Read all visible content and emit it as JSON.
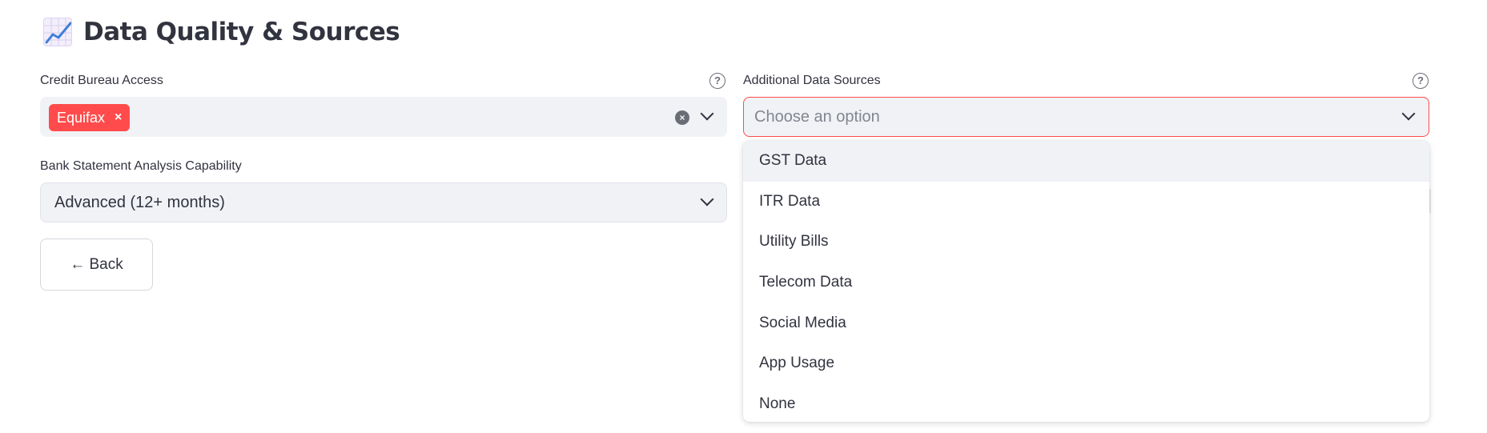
{
  "header": {
    "icon": "chart-increasing-icon",
    "title": "Data Quality & Sources"
  },
  "credit_bureau": {
    "label": "Credit Bureau Access",
    "help_icon": "help-circle-icon",
    "selected_tags": [
      {
        "label": "Equifax",
        "remove_glyph": "×"
      }
    ],
    "clear_glyph": "×",
    "accent_color": "#ff4b4b"
  },
  "additional_sources": {
    "label": "Additional Data Sources",
    "help_icon": "help-circle-icon",
    "placeholder": "Choose an option",
    "focused_border_color": "#ff4b4b",
    "options": [
      "GST Data",
      "ITR Data",
      "Utility Bills",
      "Telecom Data",
      "Social Media",
      "App Usage",
      "None"
    ],
    "highlighted_option": "GST Data"
  },
  "bank_statement": {
    "label": "Bank Statement Analysis Capability",
    "value": "Advanced (12+ months)"
  },
  "back_button": {
    "label": "← Back"
  },
  "colors": {
    "text": "#31333f",
    "input_bg": "#f0f2f6",
    "accent": "#ff4b4b"
  }
}
